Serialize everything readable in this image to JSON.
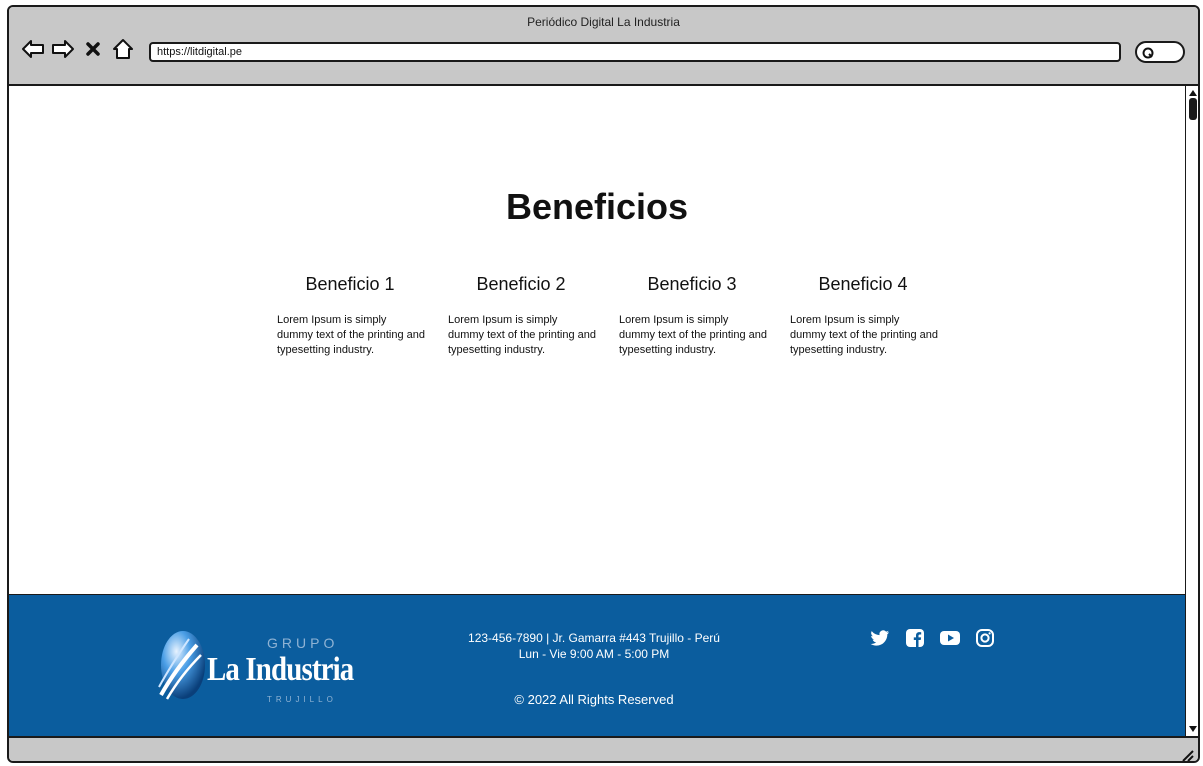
{
  "window": {
    "title": "Periódico Digital La Industria",
    "url": "https://litdigital.pe"
  },
  "nav_icons": [
    "back-arrow-icon",
    "forward-arrow-icon",
    "close-icon",
    "home-icon"
  ],
  "page": {
    "section_title": "Beneficios",
    "benefits": [
      {
        "title": "Beneficio 1",
        "text": "Lorem Ipsum is simply dummy text of the printing and typesetting industry."
      },
      {
        "title": "Beneficio 2",
        "text": "Lorem Ipsum is simply dummy text of the printing and typesetting industry."
      },
      {
        "title": "Beneficio 3",
        "text": "Lorem Ipsum is simply dummy text of the printing and typesetting industry."
      },
      {
        "title": "Beneficio 4",
        "text": "Lorem Ipsum is simply dummy text of the printing and typesetting industry."
      }
    ]
  },
  "footer": {
    "logo": {
      "grupo": "GRUPO",
      "name": "La Industria",
      "city": "TRUJILLO"
    },
    "contact_line1": "123-456-7890 | Jr. Gamarra #443 Trujillo - Perú",
    "contact_line2": "Lun - Vie 9:00 AM - 5:00 PM",
    "copyright": "© 2022 All Rights Reserved",
    "socials": [
      "twitter-icon",
      "facebook-icon",
      "youtube-icon",
      "instagram-icon"
    ],
    "background_color": "#0b5d9e"
  }
}
